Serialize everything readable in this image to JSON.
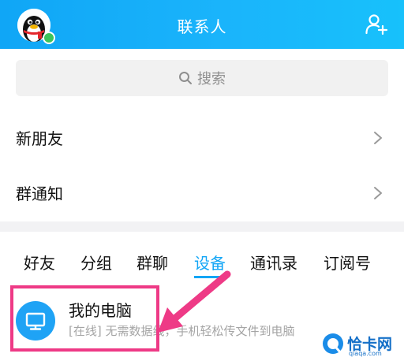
{
  "header": {
    "title": "联系人",
    "background": "#13a9f7",
    "add_contact_icon": "add-contact-icon"
  },
  "search": {
    "placeholder": "搜索",
    "icon": "search-icon"
  },
  "list": {
    "new_friends": "新朋友",
    "group_notice": "群通知"
  },
  "tabs": [
    {
      "label": "好友",
      "active": false
    },
    {
      "label": "分组",
      "active": false
    },
    {
      "label": "群聊",
      "active": false
    },
    {
      "label": "设备",
      "active": true
    },
    {
      "label": "通讯录",
      "active": false
    },
    {
      "label": "订阅号",
      "active": false
    }
  ],
  "device": {
    "name": "我的电脑",
    "status": "[在线] 无需数据线，手机轻松传文件到电脑",
    "icon": "monitor-icon"
  },
  "annotation": {
    "highlight_color": "#ee3a86"
  },
  "watermark": {
    "text": "恰卡网",
    "subtext": "qiaqa.com"
  },
  "colors": {
    "accent": "#13a6f6",
    "online": "#3cc45b"
  }
}
